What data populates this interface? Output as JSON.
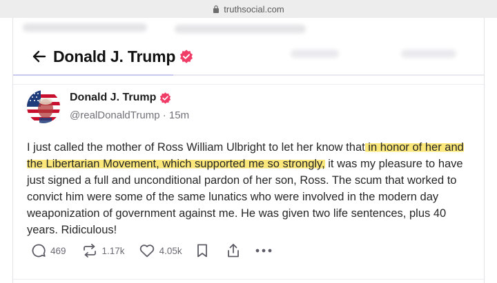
{
  "browser": {
    "url": "truthsocial.com"
  },
  "header": {
    "title": "Donald J. Trump"
  },
  "post": {
    "author_name": "Donald J. Trump",
    "handle": "@realDonaldTrump",
    "separator": "·",
    "time": "15m",
    "text": {
      "before": "I just called the mother of Ross William Ulbright to let her know that",
      "highlight": " in honor of her and the Libertarian Movement, which supported me so strongly,",
      "after": " it was my pleasure to have just signed a full and unconditional pardon of her son, Ross. The scum that worked to convict him were some of the same lunatics who were involved in the modern day weaponization of government against me. He was given two life sentences, plus 40 years. Ridiculous!"
    },
    "actions": {
      "replies": "469",
      "retruths": "1.17k",
      "likes": "4.05k"
    }
  },
  "colors": {
    "verified_badge": "#ef3d68",
    "highlight": "#fbe77a",
    "meta_text": "#707078"
  },
  "icons": [
    "lock-icon",
    "back-arrow-icon",
    "verified-badge-icon",
    "reply-icon",
    "retruth-icon",
    "like-icon",
    "bookmark-icon",
    "share-icon",
    "more-icon"
  ]
}
